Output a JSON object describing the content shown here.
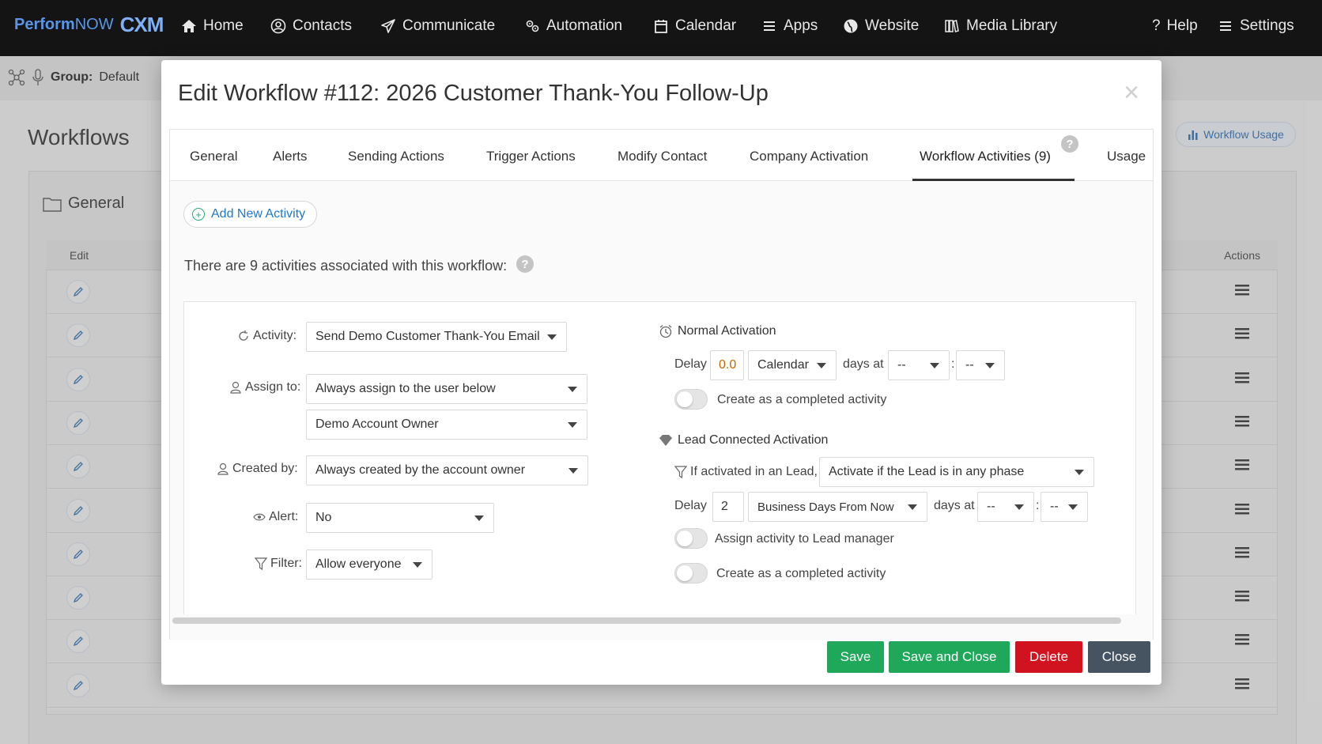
{
  "nav": {
    "brand_a": "Perform",
    "brand_b": "NOW",
    "brand_c": "CXM",
    "items": [
      {
        "label": "Home",
        "icon": "home-icon"
      },
      {
        "label": "Contacts",
        "icon": "contacts-icon"
      },
      {
        "label": "Communicate",
        "icon": "paper-plane-icon"
      },
      {
        "label": "Automation",
        "icon": "gears-icon"
      },
      {
        "label": "Calendar",
        "icon": "calendar-icon"
      },
      {
        "label": "Apps",
        "icon": "list-icon"
      },
      {
        "label": "Website",
        "icon": "globe-icon"
      },
      {
        "label": "Media Library",
        "icon": "library-icon"
      }
    ],
    "help": "Help",
    "settings": "Settings"
  },
  "background": {
    "group_label": "Group:",
    "group_value": "Default",
    "page_title": "Workflows",
    "folder": "General",
    "col_edit": "Edit",
    "col_actions": "Actions",
    "workflow_usage": "Workflow Usage"
  },
  "modal": {
    "title": "Edit Workflow #112: 2026 Customer Thank-You Follow-Up",
    "close_glyph": "×",
    "tabs": [
      "General",
      "Alerts",
      "Sending Actions",
      "Trigger Actions",
      "Modify Contact",
      "Company Activation",
      "Workflow Activities (9)",
      "Usage"
    ],
    "active_tab": "Workflow Activities (9)",
    "add_activity": "Add New Activity",
    "info_text": "There are 9 activities associated with this workflow:",
    "help_glyph": "?"
  },
  "form": {
    "activity_label": "Activity:",
    "activity_value": "Send Demo Customer Thank-You Email",
    "assign_label": "Assign to:",
    "assign_value": "Always assign to the user below",
    "assign_user": "Demo Account Owner",
    "created_label": "Created by:",
    "created_value": "Always created by the account owner",
    "alert_label": "Alert:",
    "alert_value": "No",
    "filter_label": "Filter:",
    "filter_value": "Allow everyone"
  },
  "normal": {
    "heading": "Normal Activation",
    "delay_label": "Delay",
    "delay_value": "0.0",
    "delay_unit": "Calendar",
    "days_at": "days at",
    "hour": "--",
    "colon": ":",
    "minute": "--",
    "completed": "Create as a completed activity"
  },
  "lead": {
    "heading": "Lead Connected Activation",
    "if_label": "If activated in an Lead,",
    "if_value": "Activate if the Lead is in any phase",
    "delay_label": "Delay",
    "delay_value": "2",
    "delay_unit": "Business Days From Now",
    "days_at": "days at",
    "hour": "--",
    "colon": ":",
    "minute": "--",
    "assign_manager": "Assign activity to Lead manager",
    "completed": "Create as a completed activity"
  },
  "buttons": {
    "save": "Save",
    "save_close": "Save and Close",
    "delete": "Delete",
    "close": "Close"
  },
  "colors": {
    "green": "#1fa75a",
    "red": "#d0131f",
    "dark": "#465361",
    "link": "#1f78c8"
  }
}
